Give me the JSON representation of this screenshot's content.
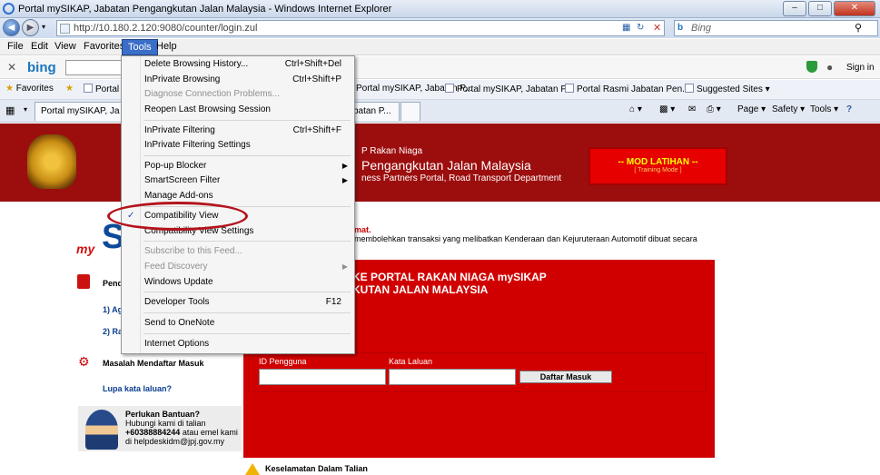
{
  "window": {
    "title": "Portal mySIKAP, Jabatan Pengangkutan Jalan Malaysia - Windows Internet Explorer",
    "controls": [
      "–",
      "□",
      "✕"
    ]
  },
  "addressbar": {
    "url": "http://10.180.2.120:9080/counter/login.zul",
    "search_placeholder": "Bing"
  },
  "menubar": {
    "items": [
      "File",
      "Edit",
      "View",
      "Favorites",
      "Tools",
      "Help"
    ]
  },
  "bingbar": {
    "logo": "bing",
    "signin": "Sign in"
  },
  "favorites": {
    "label": "Favorites",
    "items": [
      "Portal",
      "Portal mySIKAP, Jabatan P...",
      "Portal mySIKAP, Jabatan P...",
      "Portal Rasmi Jabatan Pen...",
      "Suggested Sites ▾"
    ]
  },
  "tabs": {
    "items": [
      "Portal mySIKAP, Ja",
      "batan P..."
    ],
    "commands": [
      "Page ▾",
      "Safety ▾",
      "Tools ▾",
      "?"
    ]
  },
  "banner": {
    "subtitle": "P Rakan Niaga",
    "title": "Pengangkutan Jalan Malaysia",
    "english": "ness Partners Portal, Road Transport Department",
    "mode_label": "-- MOD LATIHAN --",
    "mode_sub": "[ Training Mode ]"
  },
  "notice": {
    "heading": "mat.",
    "text": "membolehkan transaksi yang melibatkan Kenderaan dan Kejuruteraan Automotif dibuat secara"
  },
  "logo": {
    "s": "S",
    "my": "my"
  },
  "left": {
    "item1": "Pend",
    "link1": "1) Ag",
    "link2": "2) Ra",
    "login_problem": "Masalah Mendaftar Masuk",
    "forgot": "Lupa kata laluan?",
    "help_title": "Perlukan Bantuan?",
    "help_line1": "Hubungi kami di talian",
    "help_phone": "+60388884244",
    "help_line2_rest": " atau emel kami",
    "help_line3": "di helpdeskidm@jpj.gov.my"
  },
  "panel": {
    "title1": "KE PORTAL RAKAN NIAGA mySIKAP",
    "title2": "KUTAN JALAN MALAYSIA",
    "id_label": "ID Pengguna",
    "pw_label": "Kata Laluan",
    "login_button": "Daftar Masuk"
  },
  "footer": {
    "safety": "Keselamatan Dalam Talian"
  },
  "tools_menu": {
    "items": [
      {
        "label": "Delete Browsing History...",
        "shortcut": "Ctrl+Shift+Del"
      },
      {
        "label": "InPrivate Browsing",
        "shortcut": "Ctrl+Shift+P"
      },
      {
        "label": "Diagnose Connection Problems..."
      },
      {
        "label": "Reopen Last Browsing Session"
      },
      {
        "label": "InPrivate Filtering",
        "shortcut": "Ctrl+Shift+F"
      },
      {
        "label": "InPrivate Filtering Settings"
      },
      {
        "label": "Pop-up Blocker"
      },
      {
        "label": "SmartScreen Filter"
      },
      {
        "label": "Manage Add-ons"
      },
      {
        "label": "Compatibility View",
        "checked": true
      },
      {
        "label": "Compatibility View Settings"
      },
      {
        "label": "Subscribe to this Feed..."
      },
      {
        "label": "Feed Discovery"
      },
      {
        "label": "Windows Update"
      },
      {
        "label": "Developer Tools",
        "shortcut": "F12"
      },
      {
        "label": "Send to OneNote"
      },
      {
        "label": "Internet Options"
      }
    ]
  },
  "colors": {
    "banner": "#9c0e0e",
    "panel": "#d10000",
    "highlight": "#b3141c"
  }
}
